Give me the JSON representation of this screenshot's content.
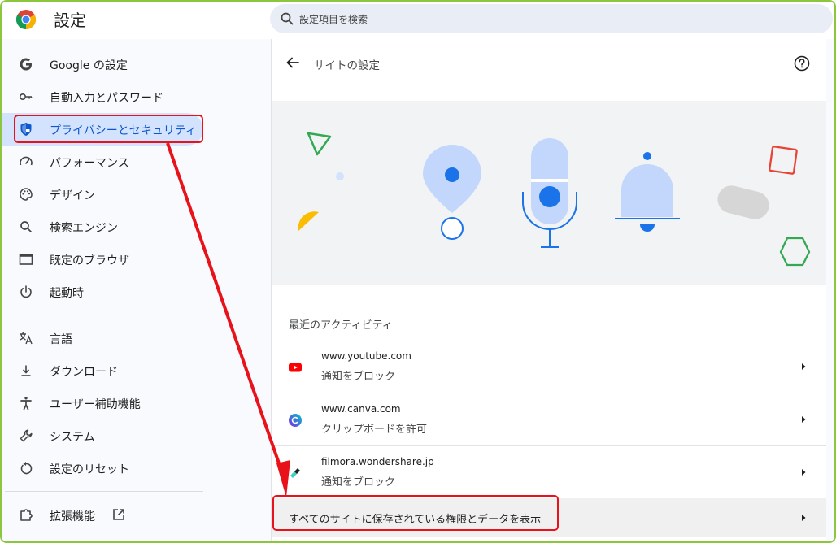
{
  "app": {
    "title": "設定"
  },
  "search": {
    "placeholder": "設定項目を検索"
  },
  "sidebar": {
    "items": [
      {
        "label": "Google の設定",
        "icon": "google-g-icon"
      },
      {
        "label": "自動入力とパスワード",
        "icon": "key-icon"
      },
      {
        "label": "プライバシーとセキュリティ",
        "icon": "shield-icon",
        "active": true
      },
      {
        "label": "パフォーマンス",
        "icon": "speedometer-icon"
      },
      {
        "label": "デザイン",
        "icon": "palette-icon"
      },
      {
        "label": "検索エンジン",
        "icon": "search-icon"
      },
      {
        "label": "既定のブラウザ",
        "icon": "browser-window-icon"
      },
      {
        "label": "起動時",
        "icon": "power-icon"
      },
      {
        "label": "言語",
        "icon": "translate-icon"
      },
      {
        "label": "ダウンロード",
        "icon": "download-icon"
      },
      {
        "label": "ユーザー補助機能",
        "icon": "accessibility-icon"
      },
      {
        "label": "システム",
        "icon": "wrench-icon"
      },
      {
        "label": "設定のリセット",
        "icon": "reset-icon"
      },
      {
        "label": "拡張機能",
        "icon": "puzzle-icon"
      }
    ]
  },
  "main": {
    "title": "サイトの設定",
    "recent_label": "最近のアクティビティ",
    "recent": [
      {
        "site": "www.youtube.com",
        "permission": "通知をブロック",
        "icon": "youtube-icon"
      },
      {
        "site": "www.canva.com",
        "permission": "クリップボードを許可",
        "icon": "canva-icon"
      },
      {
        "site": "filmora.wondershare.jp",
        "permission": "通知をブロック",
        "icon": "filmora-icon"
      }
    ],
    "all_sites_label": "すべてのサイトに保存されている権限とデータを表示"
  },
  "colors": {
    "accent": "#0b57d0",
    "active_bg": "#d3e3fd",
    "annotation": "#e8121b",
    "frame": "#8cc63f"
  }
}
